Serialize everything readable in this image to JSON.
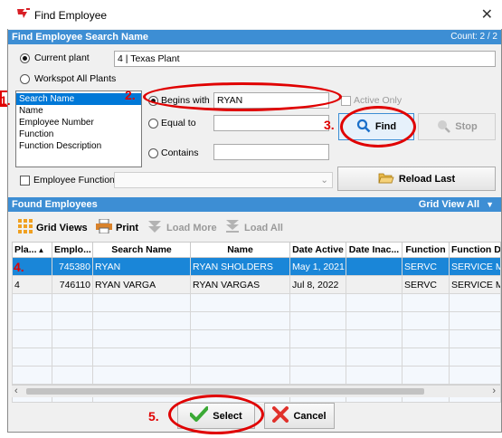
{
  "window": {
    "title": "Find Employee",
    "close_glyph": "✕"
  },
  "search_header": {
    "title": "Find Employee Search Name",
    "count": "Count: 2 / 2"
  },
  "plant": {
    "current_label": "Current plant",
    "current_value": "4                    | Texas Plant",
    "workspot_label": "Workspot All Plants"
  },
  "search_fields": [
    "Search Name",
    "Name",
    "Employee Number",
    "Function",
    "Function Description"
  ],
  "match": {
    "begins_with_label": "Begins with",
    "begins_with_value": "RYAN",
    "equal_to_label": "Equal to",
    "contains_label": "Contains",
    "active_only_label": "Active Only"
  },
  "buttons": {
    "find": "Find",
    "stop": "Stop",
    "reload_last": "Reload Last",
    "select": "Select",
    "cancel": "Cancel"
  },
  "employee_function_label": "Employee Function",
  "found_header": {
    "title": "Found Employees",
    "grid_view": "Grid View All"
  },
  "toolbar": {
    "grid_views": "Grid Views",
    "print": "Print",
    "load_more": "Load More",
    "load_all": "Load All"
  },
  "grid": {
    "columns": [
      "Pla...",
      "Emplo...",
      "Search Name",
      "Name",
      "Date Active",
      "Date Inac...",
      "Function",
      "Function D"
    ],
    "rows": [
      [
        "",
        "745380",
        "RYAN",
        "RYAN SHOLDERS",
        "May 1, 2021",
        "",
        "SERVC",
        "SERVICE M"
      ],
      [
        "4",
        "746110",
        "RYAN VARGA",
        "RYAN VARGAS",
        "Jul 8, 2022",
        "",
        "SERVC",
        "SERVICE M"
      ]
    ]
  },
  "annotations": {
    "step1": "1.",
    "step2": "2.",
    "step3": "3.",
    "step4": "4.",
    "step5": "5."
  },
  "colors": {
    "header_blue": "#3d8ed4",
    "selection_blue": "#0078d7",
    "annotation_red": "#e00000"
  }
}
